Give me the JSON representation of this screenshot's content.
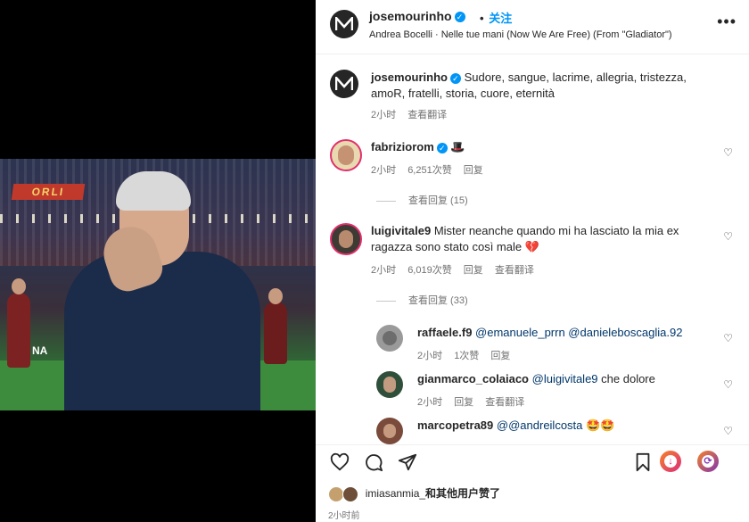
{
  "post_header": {
    "username": "josemourinho",
    "follow_label": "关注",
    "song": "Andrea Bocelli · Nelle tue mani (Now We Are Free) (From \"Gladiator\")",
    "more_label": "•••"
  },
  "photo": {
    "banner_text": "ORLI",
    "ad_text": "NA"
  },
  "caption": {
    "username": "josemourinho",
    "text": "Sudore, sangue, lacrime, allegria, tristezza, amoR, fratelli, storia, cuore, eternità",
    "time": "2小时",
    "translate": "查看翻译"
  },
  "comments": [
    {
      "username": "fabriziorom",
      "text": "🎩",
      "time": "2小时",
      "likes": "6,251次赞",
      "reply": "回复",
      "translate": "",
      "view_replies": "查看回复 (15)"
    },
    {
      "username": "luigivitale9",
      "text": "Mister neanche quando mi ha lasciato la mia ex ragazza sono stato così male 💔",
      "time": "2小时",
      "likes": "6,019次赞",
      "reply": "回复",
      "translate": "查看翻译",
      "view_replies": "查看回复 (33)"
    }
  ],
  "replies": [
    {
      "username": "raffaele.f9",
      "text": "@emanuele_prrn @danieleboscaglia.92",
      "time": "2小时",
      "likes": "1次赞",
      "reply": "回复"
    },
    {
      "username": "gianmarco_colaiaco",
      "mention": "@luigivitale9",
      "text": "che dolore",
      "time": "2小时",
      "reply": "回复",
      "translate": "查看翻译"
    },
    {
      "username": "marcopetra89",
      "text": "@@andreilcosta 🤩🤩"
    }
  ],
  "footer": {
    "liked_by_user": "imiasanmia_",
    "liked_by_rest": "和其他用户赞了",
    "time": "2小时前"
  },
  "icons": {
    "heart": "heart-icon",
    "comment": "comment-icon",
    "share": "share-icon",
    "save": "bookmark-icon"
  },
  "colors": {
    "accent": "#0095f6",
    "verified": "#0095f6",
    "text": "#262626",
    "muted": "#737373"
  }
}
